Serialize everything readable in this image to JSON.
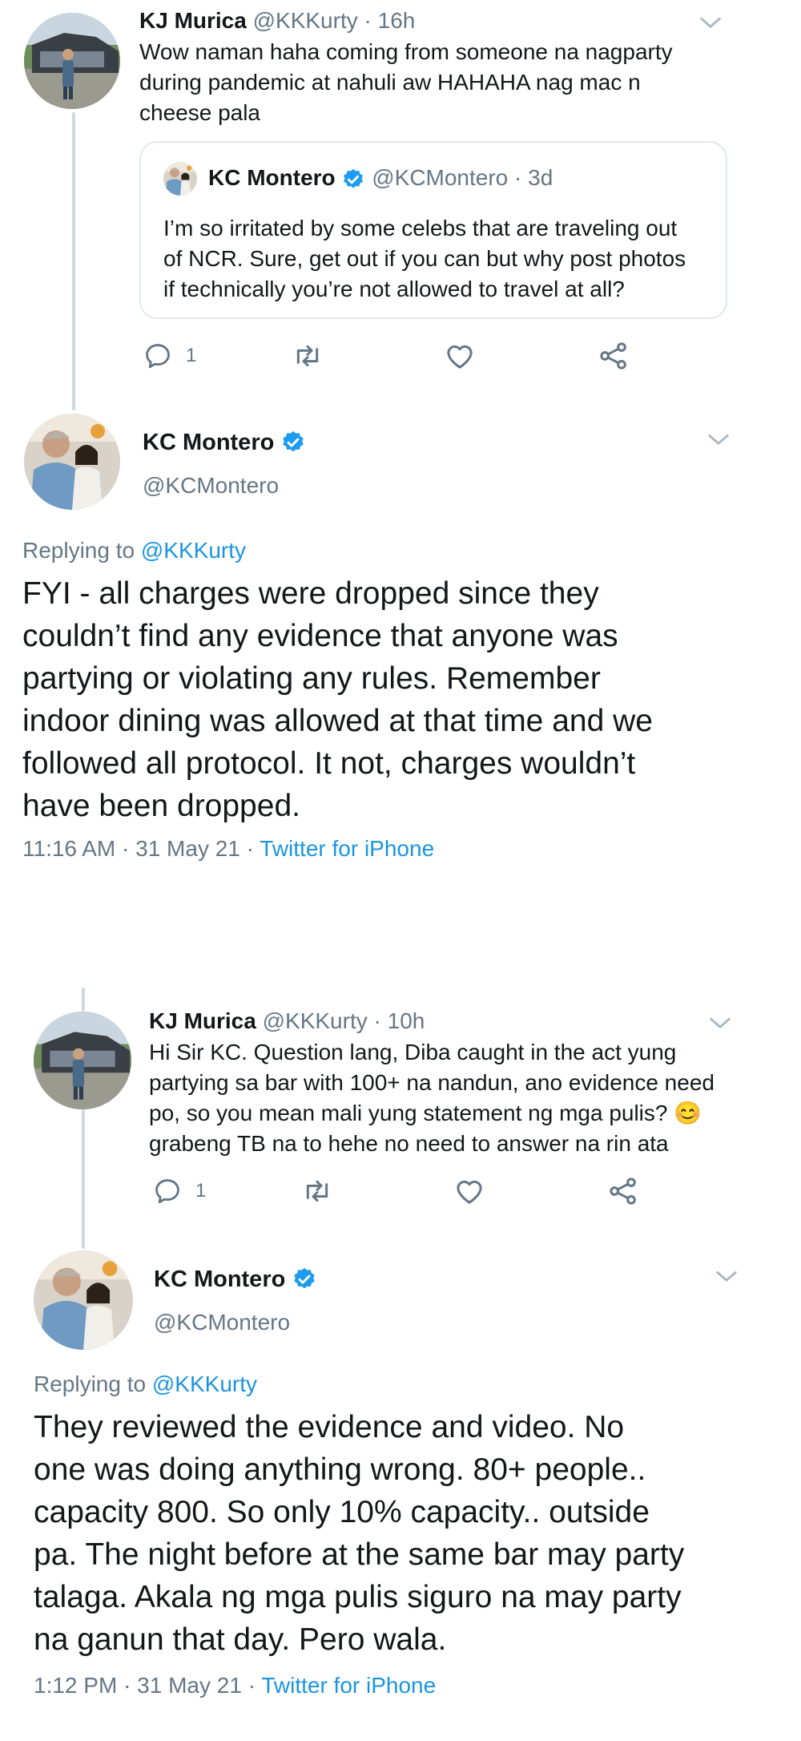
{
  "tweet1": {
    "name": "KJ Murica",
    "handle": "@KKKurty",
    "time": "16h",
    "text": "Wow naman haha coming from someone na nagparty\nduring pandemic at nahuli aw HAHAHA nag mac n\ncheese pala",
    "quote": {
      "name": "KC Montero",
      "handle": "@KCMontero",
      "time": "3d",
      "text": "I’m so irritated by some celebs that are traveling out\nof NCR. Sure, get out if you can but why post photos\nif technically you’re not allowed to travel at all?"
    },
    "reply_count": "1"
  },
  "reply1": {
    "name": "KC Montero",
    "handle": "@KCMontero",
    "replying_prefix": "Replying to",
    "replying_to": "@KKKurty",
    "text": "FYI - all charges were dropped since they\ncouldn’t find any evidence that anyone was\npartying or violating any rules. Remember\nindoor dining was allowed at that time and we\nfollowed all protocol. It not, charges wouldn’t\nhave been dropped.",
    "time": "11:16 AM",
    "date": "31 May 21",
    "source": "Twitter for iPhone"
  },
  "tweet2": {
    "name": "KJ Murica",
    "handle": "@KKKurty",
    "time": "10h",
    "text_main": "Hi Sir KC. Question lang, Diba caught in the act yung\npartying sa bar with 100+ na nandun, ano evidence need\npo, so you mean mali yung statement ng mga pulis?",
    "emoji": "😊",
    "text_end": "grabeng TB na to hehe no need to answer na rin ata",
    "reply_count": "1"
  },
  "reply2": {
    "name": "KC Montero",
    "handle": "@KCMontero",
    "replying_prefix": "Replying to",
    "replying_to": "@KKKurty",
    "text": "They reviewed the evidence and video. No\none was doing anything wrong. 80+ people..\ncapacity 800. So only 10% capacity.. outside\npa. The night before at the same bar may party\ntalaga. Akala ng mga  pulis siguro na may party\nna ganun that day. Pero wala.",
    "time": "1:12 PM",
    "date": "31 May 21",
    "source": "Twitter for iPhone"
  },
  "colors": {
    "link": "#1b95e0",
    "verified": "#1d9bf0",
    "muted": "#657786",
    "line": "#cfd9de"
  },
  "icons": [
    "reply-icon",
    "retweet-icon",
    "like-icon",
    "share-icon",
    "chevron-down-icon",
    "verified-badge-icon"
  ]
}
